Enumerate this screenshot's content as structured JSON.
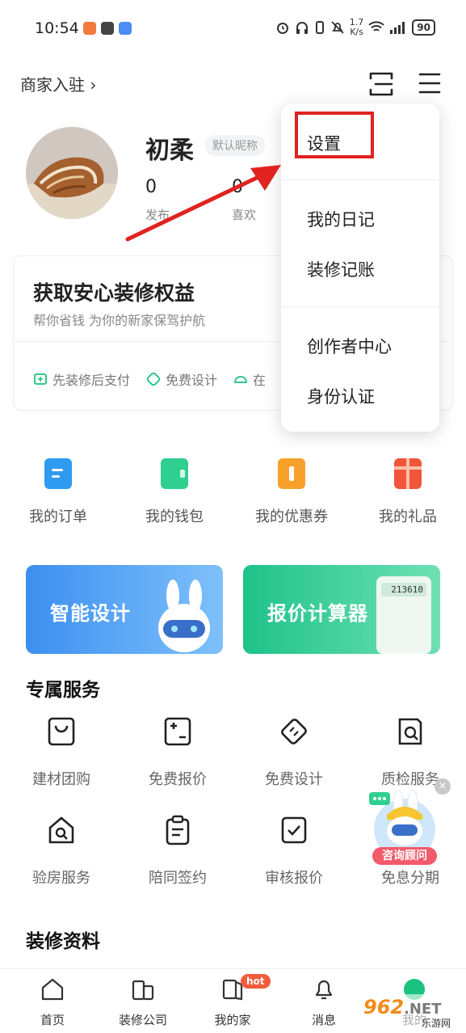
{
  "status_bar": {
    "time": "10:54",
    "speed_top": "1.7",
    "speed_bottom": "K/s",
    "battery": "90"
  },
  "header": {
    "merchant_link": "商家入驻 ›"
  },
  "profile": {
    "nickname": "初柔",
    "nickname_badge": "默认昵称",
    "stats": [
      {
        "value": "0",
        "label": "发布"
      },
      {
        "value": "0",
        "label": "喜欢"
      }
    ]
  },
  "benefit": {
    "title": "获取安心装修权益",
    "subtitle": "帮你省钱  为你的新家保驾护航",
    "features": [
      "先装修后支付",
      "免费设计",
      "在"
    ]
  },
  "quick_actions": [
    {
      "label": "我的订单",
      "icon": "order-icon",
      "color": "#2f9bf0"
    },
    {
      "label": "我的钱包",
      "icon": "wallet-icon",
      "color": "#2ecf8f"
    },
    {
      "label": "我的优惠券",
      "icon": "coupon-icon",
      "color": "#f7a12b"
    },
    {
      "label": "我的礼品",
      "icon": "gift-icon",
      "color": "#f0563a"
    }
  ],
  "banners": [
    {
      "label": "智能设计",
      "color_from": "#3c8ff0",
      "color_to": "#7ec0fa"
    },
    {
      "label": "报价计算器",
      "color_from": "#1fc38a",
      "color_to": "#6ee0b4",
      "calc_display": "213610"
    }
  ],
  "exclusive_services": {
    "title": "专属服务",
    "items": [
      {
        "label": "建材团购",
        "icon": "bag-icon"
      },
      {
        "label": "免费报价",
        "icon": "calculator-icon"
      },
      {
        "label": "免费设计",
        "icon": "ruler-icon"
      },
      {
        "label": "质检服务",
        "icon": "inspect-icon"
      },
      {
        "label": "验房服务",
        "icon": "house-search-icon"
      },
      {
        "label": "陪同签约",
        "icon": "clipboard-icon"
      },
      {
        "label": "审核报价",
        "icon": "check-doc-icon"
      },
      {
        "label": "免息分期",
        "icon": "installment-icon"
      }
    ]
  },
  "decoration_info": {
    "title": "装修资料"
  },
  "dropdown_menu": {
    "groups": [
      [
        "设置"
      ],
      [
        "我的日记",
        "装修记账"
      ],
      [
        "创作者中心",
        "身份认证"
      ]
    ]
  },
  "float_widget": {
    "label": "咨询顾问",
    "close": "×"
  },
  "tabbar": {
    "tabs": [
      {
        "label": "首页",
        "icon": "home-icon"
      },
      {
        "label": "装修公司",
        "icon": "company-icon"
      },
      {
        "label": "我的家",
        "icon": "my-home-icon"
      },
      {
        "label": "消息",
        "icon": "bell-icon"
      },
      {
        "label": "我的",
        "icon": "profile-icon"
      }
    ],
    "hot_badge": "hot"
  },
  "watermark": {
    "text": "962.NET",
    "sub": "乐游网"
  },
  "colors": {
    "accent_green": "#19c27e",
    "annotation_red": "#e0231f"
  }
}
